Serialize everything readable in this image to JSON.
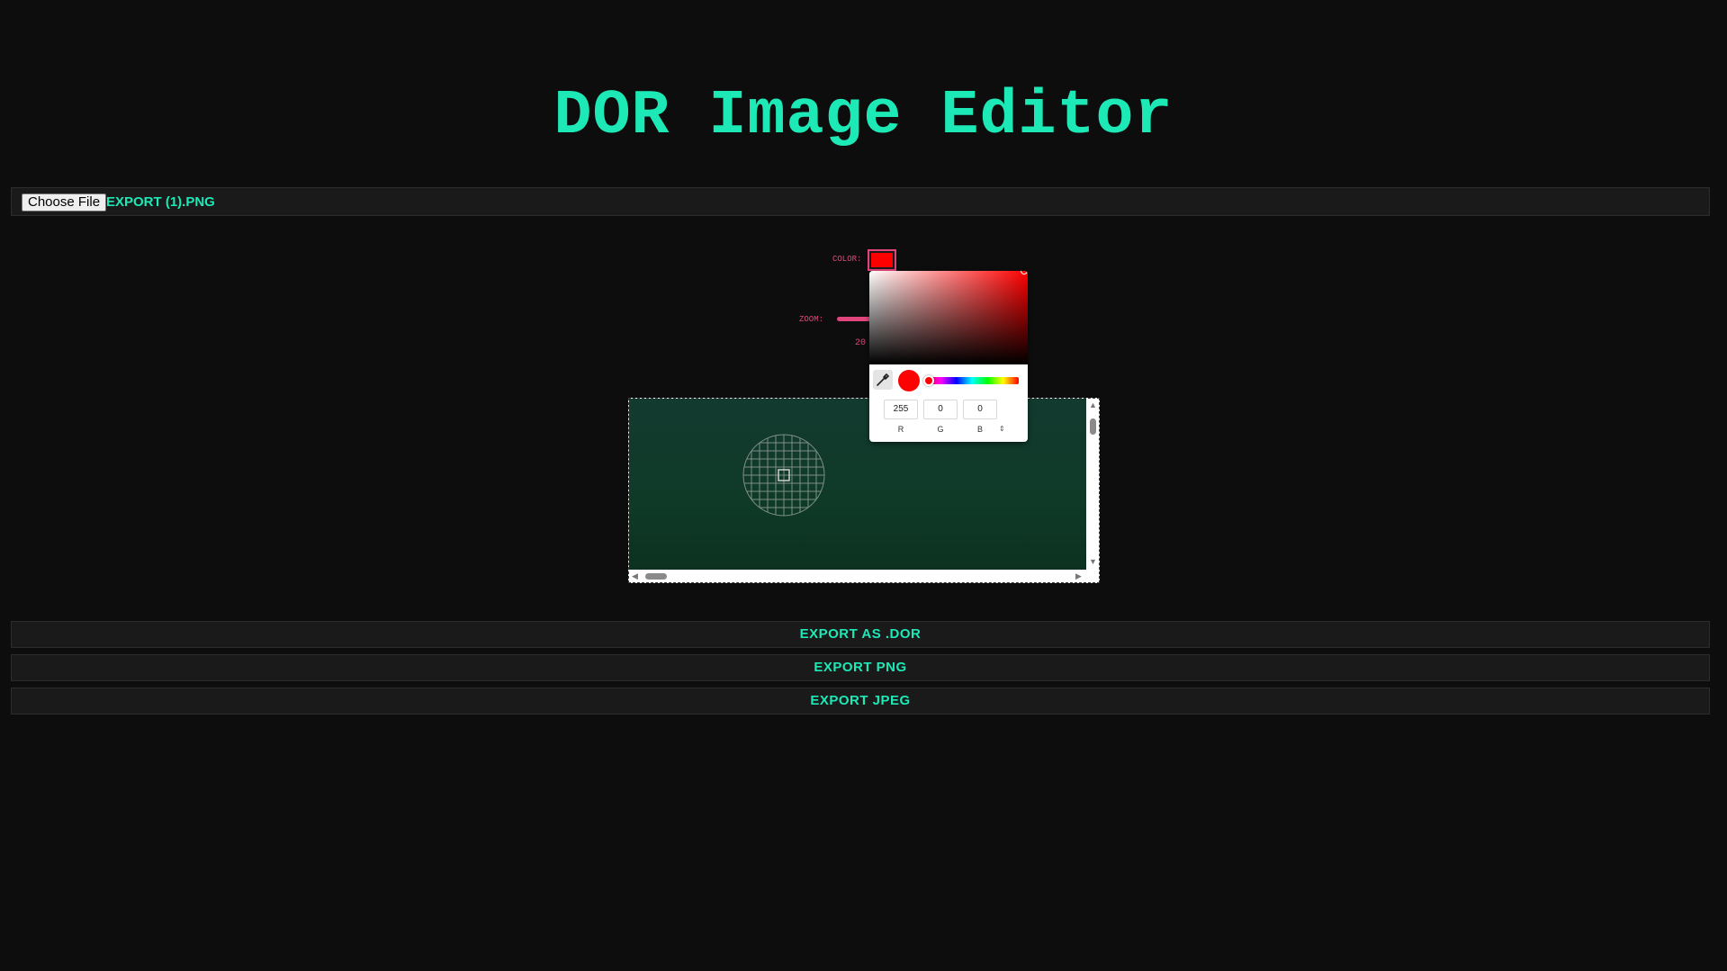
{
  "app": {
    "title": "DOR Image Editor"
  },
  "file_bar": {
    "choose_label": "Choose File",
    "file_name": "EXPORT (1).PNG"
  },
  "controls": {
    "color_label": "COLOR:",
    "zoom_label": "ZOOM:",
    "zoom_value": "20"
  },
  "color_picker": {
    "current_color": "#ff0000",
    "r": "255",
    "g": "0",
    "b": "0",
    "r_label": "R",
    "g_label": "G",
    "b_label": "B",
    "mode_toggle": "⇕"
  },
  "actions": {
    "export_dor": "EXPORT AS .DOR",
    "export_png": "EXPORT PNG",
    "export_jpeg": "EXPORT JPEG"
  },
  "colors": {
    "accent": "#1de9b6",
    "control_accent": "#e0467c",
    "background": "#0d0d0d"
  },
  "icons": {
    "eyedropper": "eyedropper-icon",
    "scroll_up": "scroll-up-arrow-icon",
    "scroll_down": "scroll-down-arrow-icon",
    "scroll_left": "scroll-left-arrow-icon",
    "scroll_right": "scroll-right-arrow-icon",
    "brush_cursor": "brush-cursor-grid-icon"
  }
}
